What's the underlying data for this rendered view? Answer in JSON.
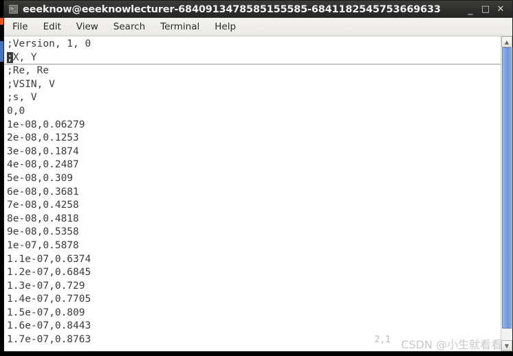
{
  "window": {
    "title": "eeeknow@eeeknowlecturer-6840913478585155585-6841182545753669633",
    "icon": "terminal-icon",
    "controls": {
      "minimize": "_",
      "maximize": "□",
      "close": "✕"
    }
  },
  "menu": {
    "items": [
      {
        "label": "File"
      },
      {
        "label": "Edit"
      },
      {
        "label": "View"
      },
      {
        "label": "Search"
      },
      {
        "label": "Terminal"
      },
      {
        "label": "Help"
      }
    ]
  },
  "terminal": {
    "lines": [
      ";Version, 1, 0",
      ";X, Y",
      ";Re, Re",
      ";VSIN, V",
      ";s, V",
      "0,0",
      "1e-08,0.06279",
      "2e-08,0.1253",
      "3e-08,0.1874",
      "4e-08,0.2487",
      "5e-08,0.309",
      "6e-08,0.3681",
      "7e-08,0.4258",
      "8e-08,0.4818",
      "9e-08,0.5358",
      "1e-07,0.5878",
      "1.1e-07,0.6374",
      "1.2e-07,0.6845",
      "1.3e-07,0.729",
      "1.4e-07,0.7705",
      "1.5e-07,0.809",
      "1.6e-07,0.8443",
      "1.7e-07,0.8763"
    ],
    "cursor_line_index": 1,
    "cursor_char": ";",
    "cursor_line_rest": "X, Y",
    "status_position": "2,1",
    "text_color": "#3a3a3a",
    "background_color": "#ffffff"
  },
  "scrollbar": {
    "up_arrow": "▲",
    "down_arrow": "▼",
    "thumb_color": "#7fa3dc"
  },
  "watermark": {
    "text": "CSDN @小生就看看"
  }
}
